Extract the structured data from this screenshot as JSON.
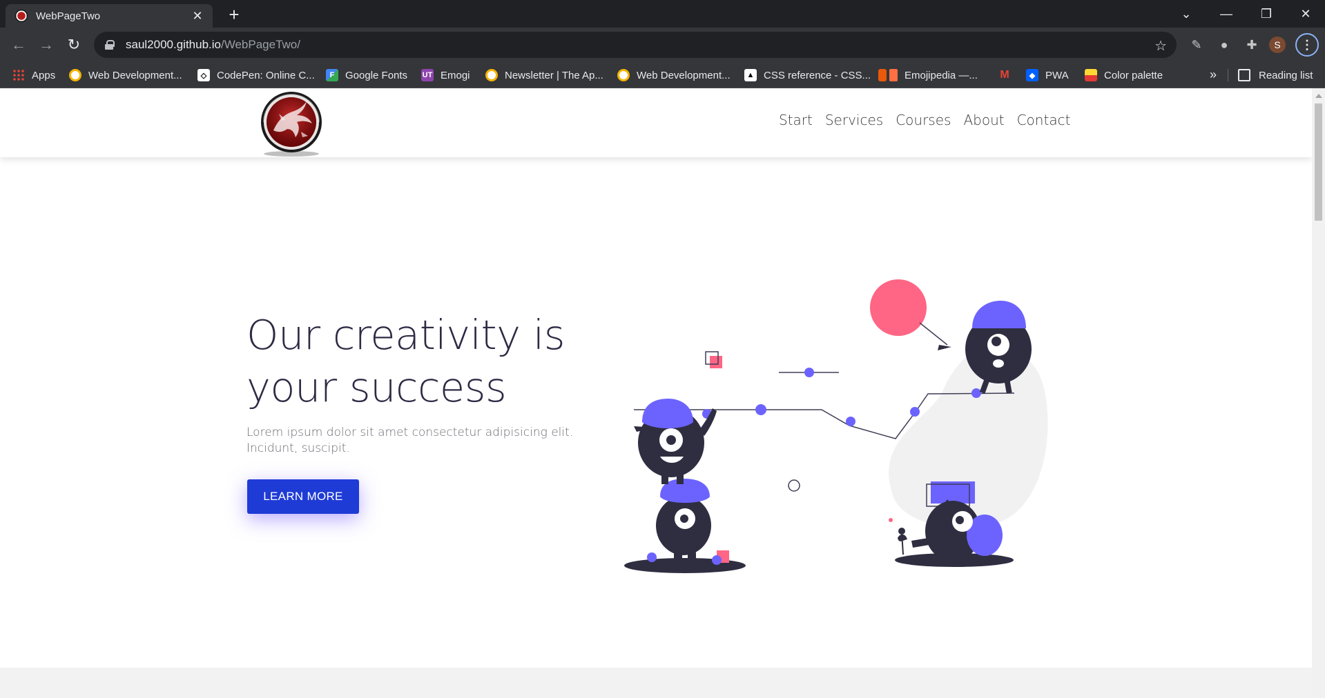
{
  "browser": {
    "tab_title": "WebPageTwo",
    "tab_close": "✕",
    "new_tab": "+",
    "url_host": "saul2000.github.io",
    "url_path": "/WebPageTwo/",
    "profile_initial": "S",
    "bookmarks": [
      {
        "label": "Apps",
        "icon": "apps-grid-icon",
        "color": "#ea4335"
      },
      {
        "label": "Web Development...",
        "icon": "web-dev-icon",
        "color": "#f4b400"
      },
      {
        "label": "CodePen: Online C...",
        "icon": "codepen-icon",
        "color": "#ffffff"
      },
      {
        "label": "Google Fonts",
        "icon": "google-fonts-icon",
        "color": "#4285f4"
      },
      {
        "label": "Emogi",
        "icon": "emogi-icon",
        "color": "#8e44ad"
      },
      {
        "label": "Newsletter | The Ap...",
        "icon": "newsletter-icon",
        "color": "#f4b400"
      },
      {
        "label": "Web Development...",
        "icon": "web-dev-icon",
        "color": "#f4b400"
      },
      {
        "label": "CSS reference - CSS...",
        "icon": "css-ref-icon",
        "color": "#000000"
      },
      {
        "label": "Emojipedia —...",
        "icon": "emojipedia-icon",
        "color": "#e8590c"
      },
      {
        "label": "",
        "icon": "gmail-icon",
        "color": "#ea4335"
      },
      {
        "label": "PWA",
        "icon": "dropbox-icon",
        "color": "#0061ff"
      },
      {
        "label": "Color palette",
        "icon": "color-palette-icon",
        "color": "#fdd835"
      }
    ],
    "more_bookmarks": "»",
    "reading_list": "Reading list"
  },
  "site": {
    "nav": [
      "Start",
      "Services",
      "Courses",
      "About",
      "Contact"
    ],
    "hero_title": "Our creativity is your success",
    "hero_text": "Lorem ipsum dolor sit amet consectetur adipisicing elit. Incidunt, suscipit.",
    "cta_label": "LEARN MORE"
  },
  "colors": {
    "accent": "#1f3bd6",
    "monster_purple": "#6c63ff",
    "monster_dark": "#2f2e41",
    "balloon_pink": "#ff6584"
  }
}
